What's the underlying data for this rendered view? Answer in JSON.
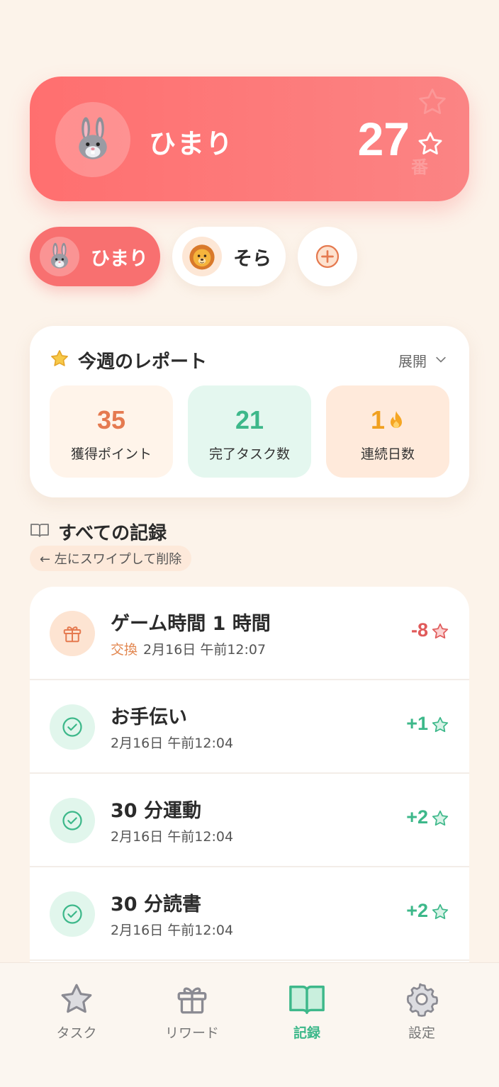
{
  "profile": {
    "name": "ひまり",
    "points": "27",
    "deco_text": "番"
  },
  "children": [
    {
      "name": "ひまり",
      "avatar": "rabbit-face",
      "active": true
    },
    {
      "name": "そら",
      "avatar": "lion-face",
      "active": false
    }
  ],
  "add_child_icon": "plus-circle-icon",
  "report": {
    "title": "今週のレポート",
    "expand_label": "展開",
    "stats": [
      {
        "value": "35",
        "label": "獲得ポイント"
      },
      {
        "value": "21",
        "label": "完了タスク数"
      },
      {
        "value": "1",
        "label": "連続日数"
      }
    ]
  },
  "history": {
    "title": "すべての記録",
    "swipe_hint": "← 左にスワイプして削除",
    "records": [
      {
        "title": "ゲーム時間 1 時間",
        "tag": "交換",
        "date": "2月16日 午前12:07",
        "points": "-8",
        "type": "exchange"
      },
      {
        "title": "お手伝い",
        "tag": "",
        "date": "2月16日 午前12:04",
        "points": "+1",
        "type": "task"
      },
      {
        "title": "30 分運動",
        "tag": "",
        "date": "2月16日 午前12:04",
        "points": "+2",
        "type": "task"
      },
      {
        "title": "30 分読書",
        "tag": "",
        "date": "2月16日 午前12:04",
        "points": "+2",
        "type": "task"
      }
    ]
  },
  "tabs": [
    {
      "label": "タスク",
      "icon": "star-icon",
      "active": false
    },
    {
      "label": "リワード",
      "icon": "gift-icon",
      "active": false
    },
    {
      "label": "記録",
      "icon": "book-icon",
      "active": true
    },
    {
      "label": "設定",
      "icon": "gear-icon",
      "active": false
    }
  ],
  "colors": {
    "accent_red": "#f87070",
    "accent_green": "#3db88a",
    "accent_orange": "#e57a50",
    "background": "#fcf3ea"
  }
}
